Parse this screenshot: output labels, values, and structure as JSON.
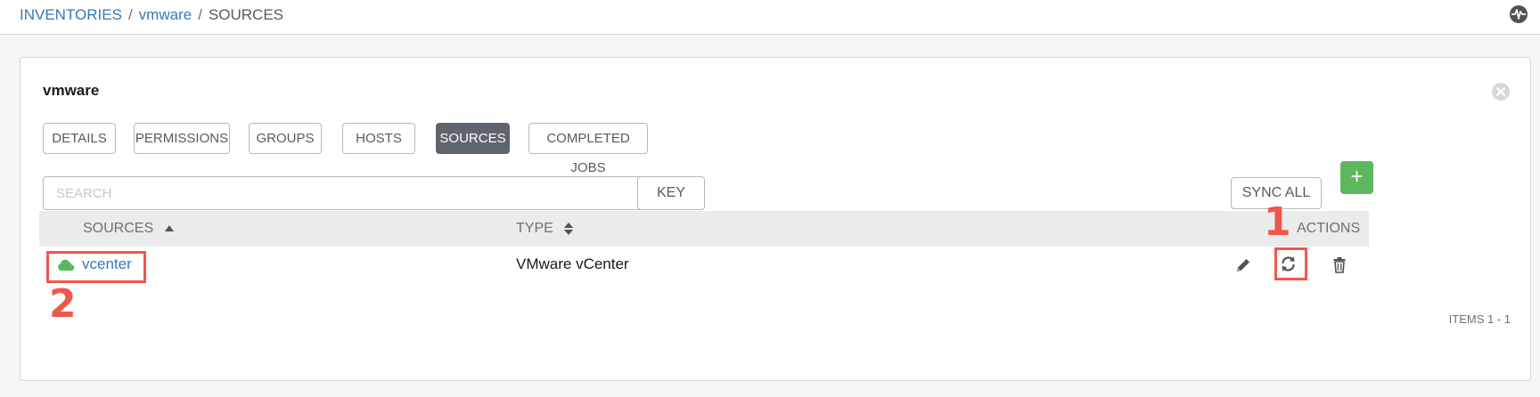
{
  "breadcrumb": {
    "items": [
      "INVENTORIES",
      "vmware"
    ],
    "separator": "/",
    "current": "SOURCES"
  },
  "header_icon": "activity-stream-icon",
  "panel": {
    "title": "vmware",
    "close_icon": "close-icon"
  },
  "tabs": [
    {
      "label": "DETAILS",
      "active": false
    },
    {
      "label": "PERMISSIONS",
      "active": false
    },
    {
      "label": "GROUPS",
      "active": false
    },
    {
      "label": "HOSTS",
      "active": false
    },
    {
      "label": "SOURCES",
      "active": true
    },
    {
      "label": "COMPLETED JOBS",
      "active": false
    }
  ],
  "search": {
    "placeholder": "SEARCH",
    "value": "",
    "icon": "search-icon",
    "key_label": "KEY"
  },
  "toolbar": {
    "sync_all_label": "SYNC ALL",
    "add_label": "+"
  },
  "table": {
    "columns": [
      "SOURCES",
      "TYPE",
      "ACTIONS"
    ],
    "sort": {
      "SOURCES": "ascending",
      "TYPE": "unsorted"
    },
    "rows": [
      {
        "name": "vcenter",
        "type": "VMware vCenter",
        "status_icon": "cloud-icon",
        "actions": [
          "pencil-icon",
          "refresh-icon",
          "trash-icon"
        ]
      }
    ],
    "items_label": "ITEMS  1 - 1"
  },
  "annotations": [
    {
      "number": "1",
      "target": "sync-source-button"
    },
    {
      "number": "2",
      "target": "source-name-link"
    }
  ],
  "colors": {
    "link": "#337ab7",
    "active_tab": "#5f656d",
    "success": "#5cb85c",
    "annotation": "#f0564a"
  }
}
